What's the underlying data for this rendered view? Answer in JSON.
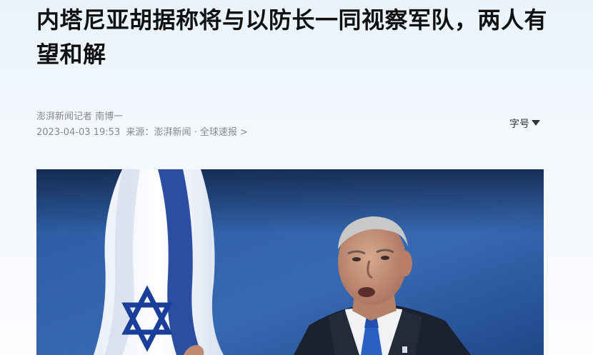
{
  "article": {
    "headline": "内塔尼亚胡据称将与以防长一同视察军队，两人有望和解",
    "byline": "澎湃新闻记者 南博一",
    "datetime": "2023-04-03 19:53",
    "source_prefix": "来源：",
    "source": "澎湃新闻 · 全球速报",
    "source_chevron": ">",
    "font_size_label": "字号",
    "font_size_icon": "triangle-down-icon"
  },
  "photo": {
    "subject": "speaker-with-israeli-flag",
    "colors": {
      "background": "#2d5fa3",
      "flag_white": "#f2f5fa",
      "flag_blue": "#1a3f9a",
      "suit": "#1a2130",
      "shirt": "#f0f2f4",
      "tie": "#2a5fc4",
      "skin": "#c9957c",
      "hair": "#c8c8c8"
    }
  }
}
